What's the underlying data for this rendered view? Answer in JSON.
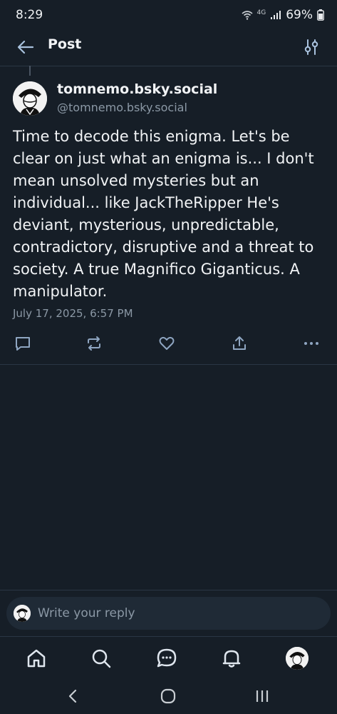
{
  "status": {
    "time": "8:29",
    "network": "4G",
    "battery": "69%"
  },
  "header": {
    "title": "Post",
    "back_icon": "arrow-left-icon",
    "filter_icon": "sliders-icon"
  },
  "post": {
    "display_name": "tomnemo.bsky.social",
    "handle": "@tomnemo.bsky.social",
    "text": "Time to decode this enigma. Let's be clear on just what an enigma is... I don't mean unsolved mysteries but an individual... like JackTheRipper He's deviant, mysterious, unpredictable, contradictory, disruptive and a threat to society. A true Magnifico Giganticus. A manipulator.",
    "timestamp": "July 17, 2025, 6:57 PM"
  },
  "actions": [
    "reply-icon",
    "repost-icon",
    "like-icon",
    "share-icon",
    "more-icon"
  ],
  "reply": {
    "placeholder": "Write your reply"
  },
  "bottom_nav": [
    "home-icon",
    "search-icon",
    "chat-icon",
    "bell-icon",
    "profile-avatar"
  ],
  "system_nav": [
    "back-chevron-icon",
    "home-circle-icon",
    "recents-icon"
  ],
  "colors": {
    "background": "#161e27",
    "text": "#f1f3f5",
    "muted": "#8b98a5",
    "divider": "#2a3644"
  }
}
